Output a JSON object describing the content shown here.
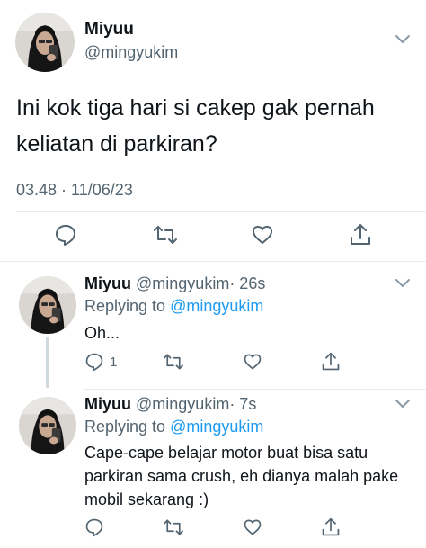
{
  "main_tweet": {
    "author_name": "Miyuu",
    "author_handle": "@mingyukim",
    "text": "Ini kok tiga hari si cakep gak pernah keliatan di parkiran?",
    "timestamp": "03.48 · 11/06/23",
    "actions": [
      "reply-icon",
      "retweet-icon",
      "like-icon",
      "share-icon"
    ]
  },
  "replies": [
    {
      "author_name": "Miyuu",
      "author_handle": "@mingyukim",
      "time": "· 26s",
      "replying_prefix": "Replying to",
      "replying_to": "@mingyukim",
      "text": "Oh...",
      "reply_count": "1"
    },
    {
      "author_name": "Miyuu",
      "author_handle": "@mingyukim",
      "time": "· 7s",
      "replying_prefix": "Replying to",
      "replying_to": "@mingyukim",
      "text": "Cape-cape belajar motor buat bisa satu parkiran sama crush, eh dianya malah pake mobil sekarang :)",
      "reply_count": ""
    }
  ],
  "colors": {
    "text": "#0f1419",
    "secondary": "#536471",
    "link": "#1d9bf0",
    "divider": "#e6eaed"
  }
}
